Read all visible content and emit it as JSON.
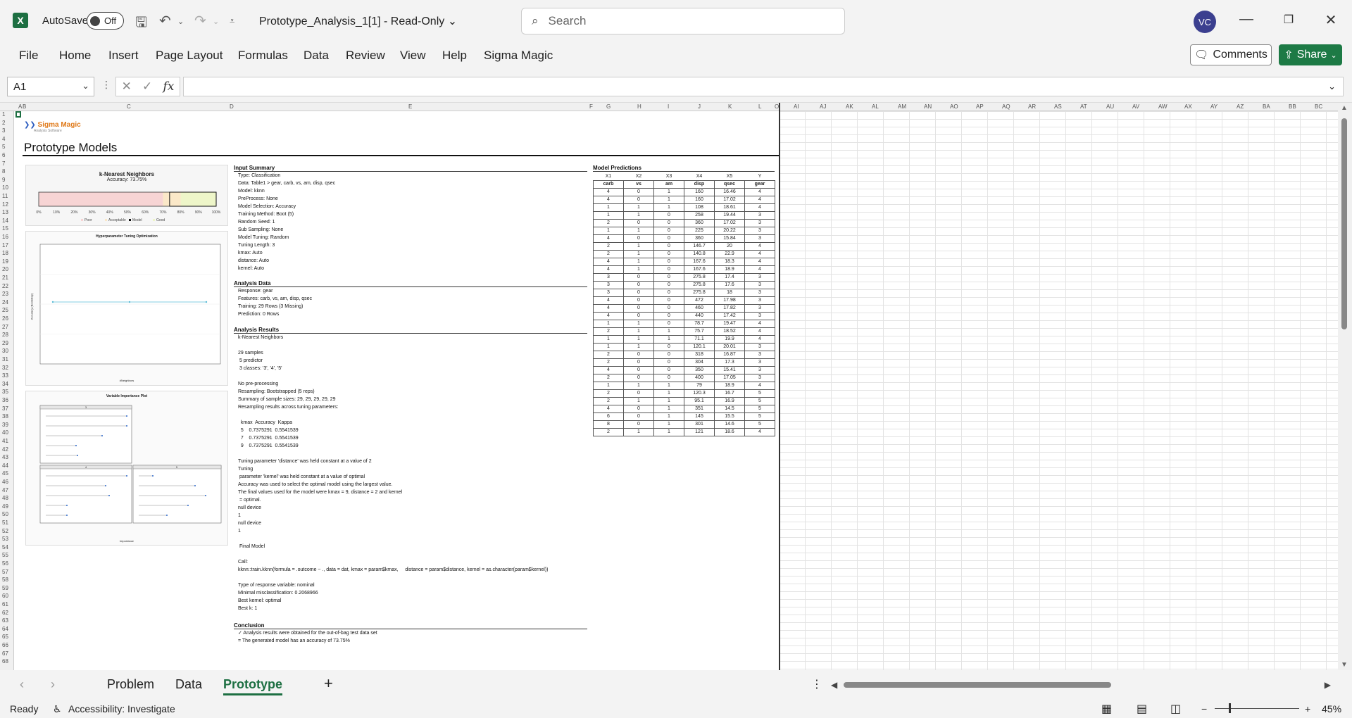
{
  "app": {
    "autosave_label": "AutoSave",
    "autosave_state": "Off",
    "doc_title": "Prototype_Analysis_1[1]  -  Read-Only",
    "search_placeholder": "Search",
    "user_initials": "VC"
  },
  "ribbon": {
    "tabs": [
      "File",
      "Home",
      "Insert",
      "Page Layout",
      "Formulas",
      "Data",
      "Review",
      "View",
      "Help",
      "Sigma Magic"
    ],
    "comments_label": "Comments",
    "share_label": "Share"
  },
  "formula_bar": {
    "name_box": "A1",
    "fx_label": "fx",
    "formula": ""
  },
  "columns": [
    "A",
    "B",
    "C",
    "D",
    "E",
    "F",
    "G",
    "H",
    "I",
    "J",
    "K",
    "L",
    "O",
    "AI",
    "AJ",
    "AK",
    "AL",
    "AM",
    "AN",
    "AO",
    "AP",
    "AQ",
    "AR",
    "AS",
    "AT",
    "AU",
    "AV",
    "AW",
    "AX",
    "AY",
    "AZ",
    "BA",
    "BB",
    "BC"
  ],
  "sheet": {
    "logo_text": "Sigma Magic",
    "logo_sub": "Analysis Software",
    "title": "Prototype Models",
    "gauge": {
      "title": "k-Nearest Neighbors",
      "subtitle": "Accuracy: 73.75%",
      "value": 73.75,
      "ticks": [
        "0%",
        "10%",
        "20%",
        "30%",
        "40%",
        "50%",
        "60%",
        "70%",
        "80%",
        "90%",
        "100%"
      ],
      "legend": [
        "Poor",
        "Acceptable",
        "Model",
        "Good"
      ],
      "colors": {
        "poor": "#f7d4d4",
        "acceptable": "#fbe8c8",
        "good": "#eef6c9"
      }
    },
    "tuning_plot": {
      "title": "Hyperparameter Tuning Optimization",
      "xlabel": "#Neighbors",
      "ylabel": "Accuracy (Bootstrap)",
      "color": "#5bbbd6"
    },
    "varimp_plot": {
      "title": "Variable Importance Plot",
      "xlabel": "Importance",
      "panels": [
        "3",
        "4",
        "5"
      ]
    },
    "input_summary": {
      "header": "Input Summary",
      "lines": [
        "Type: Classification",
        "Data: Table1 > gear, carb, vs, am, disp, qsec",
        "Model: kknn",
        "PreProcess: None",
        "Model Selection: Accuracy",
        "Training Method: Boot (5)",
        "Random Seed: 1",
        "Sub Sampling: None",
        "Model Tuning: Random",
        "Tuning Length: 3",
        "kmax: Auto",
        "distance: Auto",
        "kernel: Auto"
      ]
    },
    "analysis_data": {
      "header": "Analysis Data",
      "lines": [
        "Response: gear",
        "Features: carb, vs, am, disp, qsec",
        "Training: 29 Rows (3 Missing)",
        "Prediction: 0 Rows"
      ]
    },
    "analysis_results": {
      "header": "Analysis Results",
      "text": "k-Nearest Neighbors\n\n29 samples\n 5 predictor\n 3 classes: '3', '4', '5'\n\nNo pre-processing\nResampling: Bootstrapped (5 reps)\nSummary of sample sizes: 29, 29, 29, 29, 29\nResampling results across tuning parameters:\n\n  kmax  Accuracy  Kappa\n  5    0.7375291  0.5541539\n  7    0.7375291  0.5541539\n  9    0.7375291  0.5541539\n\nTuning parameter 'distance' was held constant at a value of 2\nTuning\n parameter 'kernel' was held constant at a value of optimal\nAccuracy was used to select the optimal model using the largest value.\nThe final values used for the model were kmax = 9, distance = 2 and kernel\n = optimal.\nnull device\n1\nnull device\n1\n\n Final Model\n\nCall:\nkknn::train.kknn(formula = .outcome ~ ., data = dat, kmax = param$kmax,     distance = param$distance, kernel = as.character(param$kernel))\n\nType of response variable: nominal\nMinimal misclassification: 0.2068966\nBest kernel: optimal\nBest k: 1"
    },
    "conclusion": {
      "header": "Conclusion",
      "lines": [
        "✓ Analysis results were obtained for the out-of-bag test data set",
        "= The generated model has an accuracy of 73.75%"
      ]
    },
    "predictions": {
      "header": "Model Predictions",
      "xlabels": [
        "X1",
        "X2",
        "X3",
        "X4",
        "X5",
        "Y"
      ],
      "columns": [
        "carb",
        "vs",
        "am",
        "disp",
        "qsec",
        "gear"
      ],
      "rows": [
        [
          "4",
          "0",
          "1",
          "160",
          "16.46",
          "4"
        ],
        [
          "4",
          "0",
          "1",
          "160",
          "17.02",
          "4"
        ],
        [
          "1",
          "1",
          "1",
          "108",
          "18.61",
          "4"
        ],
        [
          "1",
          "1",
          "0",
          "258",
          "19.44",
          "3"
        ],
        [
          "2",
          "0",
          "0",
          "360",
          "17.02",
          "3"
        ],
        [
          "1",
          "1",
          "0",
          "225",
          "20.22",
          "3"
        ],
        [
          "4",
          "0",
          "0",
          "360",
          "15.84",
          "3"
        ],
        [
          "2",
          "1",
          "0",
          "146.7",
          "20",
          "4"
        ],
        [
          "2",
          "1",
          "0",
          "140.8",
          "22.9",
          "4"
        ],
        [
          "4",
          "1",
          "0",
          "167.6",
          "18.3",
          "4"
        ],
        [
          "4",
          "1",
          "0",
          "167.6",
          "18.9",
          "4"
        ],
        [
          "3",
          "0",
          "0",
          "275.8",
          "17.4",
          "3"
        ],
        [
          "3",
          "0",
          "0",
          "275.8",
          "17.6",
          "3"
        ],
        [
          "3",
          "0",
          "0",
          "275.8",
          "18",
          "3"
        ],
        [
          "4",
          "0",
          "0",
          "472",
          "17.98",
          "3"
        ],
        [
          "4",
          "0",
          "0",
          "460",
          "17.82",
          "3"
        ],
        [
          "4",
          "0",
          "0",
          "440",
          "17.42",
          "3"
        ],
        [
          "1",
          "1",
          "0",
          "78.7",
          "19.47",
          "4"
        ],
        [
          "2",
          "1",
          "1",
          "75.7",
          "18.52",
          "4"
        ],
        [
          "1",
          "1",
          "1",
          "71.1",
          "19.9",
          "4"
        ],
        [
          "1",
          "1",
          "0",
          "120.1",
          "20.01",
          "3"
        ],
        [
          "2",
          "0",
          "0",
          "318",
          "16.87",
          "3"
        ],
        [
          "2",
          "0",
          "0",
          "304",
          "17.3",
          "3"
        ],
        [
          "4",
          "0",
          "0",
          "350",
          "15.41",
          "3"
        ],
        [
          "2",
          "0",
          "0",
          "400",
          "17.05",
          "3"
        ],
        [
          "1",
          "1",
          "1",
          "79",
          "18.9",
          "4"
        ],
        [
          "2",
          "0",
          "1",
          "120.3",
          "16.7",
          "5"
        ],
        [
          "2",
          "1",
          "1",
          "95.1",
          "16.9",
          "5"
        ],
        [
          "4",
          "0",
          "1",
          "351",
          "14.5",
          "5"
        ],
        [
          "6",
          "0",
          "1",
          "145",
          "15.5",
          "5"
        ],
        [
          "8",
          "0",
          "1",
          "301",
          "14.6",
          "5"
        ],
        [
          "2",
          "1",
          "1",
          "121",
          "18.6",
          "4"
        ]
      ]
    }
  },
  "sheet_tabs": [
    "Problem",
    "Data",
    "Prototype"
  ],
  "active_sheet": "Prototype",
  "status": {
    "ready": "Ready",
    "accessibility": "Accessibility: Investigate",
    "zoom": "45%"
  }
}
